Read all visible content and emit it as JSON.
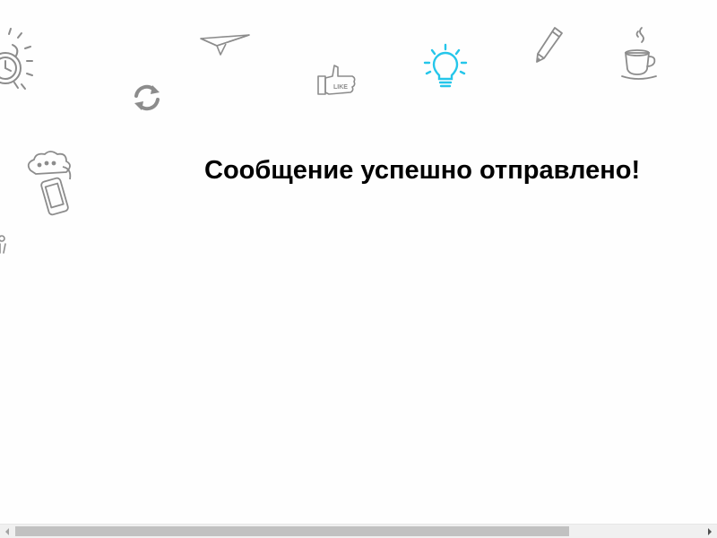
{
  "page": {
    "message": "Сообщение успешно отправлено!",
    "accent_color": "#25c6ea",
    "doodle_color": "#8c8c8c"
  },
  "decorations": [
    {
      "icon": "alarm-clock-icon"
    },
    {
      "icon": "refresh-icon"
    },
    {
      "icon": "paper-plane-icon"
    },
    {
      "icon": "thumbs-up-like-icon",
      "label": "LIKE"
    },
    {
      "icon": "lightbulb-icon"
    },
    {
      "icon": "pencil-icon"
    },
    {
      "icon": "coffee-cup-icon"
    },
    {
      "icon": "chat-phone-icon"
    },
    {
      "icon": "small-doodle-icon"
    }
  ],
  "scrollbar": {
    "orientation": "horizontal",
    "position_fraction": 0.0,
    "visible_fraction": 0.8
  }
}
